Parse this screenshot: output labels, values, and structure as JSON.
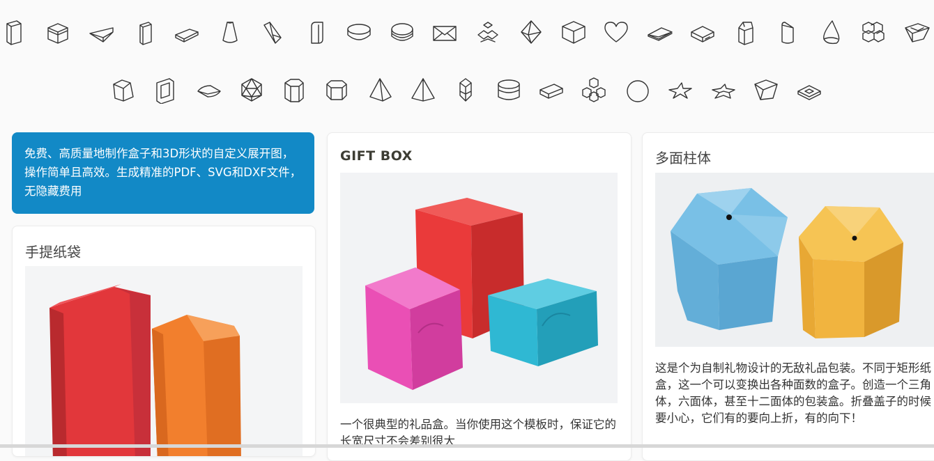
{
  "shapes_row1": [
    {
      "name": "tall-box-icon"
    },
    {
      "name": "cube-box-icon"
    },
    {
      "name": "wedge-icon"
    },
    {
      "name": "thin-box-icon"
    },
    {
      "name": "flat-box-icon"
    },
    {
      "name": "cone-icon"
    },
    {
      "name": "slanted-prism-icon"
    },
    {
      "name": "rounded-box-icon"
    },
    {
      "name": "oval-tin-icon"
    },
    {
      "name": "oval-box-icon"
    },
    {
      "name": "envelope-icon"
    },
    {
      "name": "flower-box-icon"
    },
    {
      "name": "octahedron-icon"
    },
    {
      "name": "hex-cube-icon"
    },
    {
      "name": "heart-box-icon"
    },
    {
      "name": "sleeve-envelope-icon"
    },
    {
      "name": "matchbox-icon"
    },
    {
      "name": "milk-carton-icon"
    },
    {
      "name": "cut-cylinder-icon"
    },
    {
      "name": "drop-icon"
    },
    {
      "name": "stacked-cubes-icon"
    },
    {
      "name": "tray-icon"
    }
  ],
  "shapes_row2": [
    {
      "name": "pentagon-prism-icon"
    },
    {
      "name": "frame-box-icon"
    },
    {
      "name": "pillow-box-icon"
    },
    {
      "name": "icosahedron-icon"
    },
    {
      "name": "hexagonal-prism-icon"
    },
    {
      "name": "octagon-box-icon"
    },
    {
      "name": "tetrahedron-icon"
    },
    {
      "name": "pyramid-icon"
    },
    {
      "name": "gem-icon"
    },
    {
      "name": "round-box-icon"
    },
    {
      "name": "flat-tray-icon"
    },
    {
      "name": "cube-cluster-icon"
    },
    {
      "name": "sphere-icon"
    },
    {
      "name": "star-flat-icon"
    },
    {
      "name": "star-box-icon"
    },
    {
      "name": "pentagon-box-icon"
    },
    {
      "name": "coaster-icon"
    }
  ],
  "intro": {
    "text": "免费、高质量地制作盒子和3D形状的自定义展开图，操作简单且高效。生成精准的PDF、SVG和DXF文件，无隐藏费用"
  },
  "cards": {
    "paper_bag": {
      "title": "手提纸袋"
    },
    "gift_box": {
      "title": "GIFT BOX",
      "desc": "一个很典型的礼品盒。当你使用这个模板时，保证它的长宽尺寸不会差别很大"
    },
    "prism": {
      "title": "多面柱体",
      "desc": "这是个为自制礼物设计的无敌礼品包装。不同于矩形纸盒，这一个可以变换出各种面数的盒子。创造一个三角体，六面体，甚至十二面体的包装盒。折叠盖子的时候要小心，它们有的要向上折，有的向下！"
    }
  },
  "colors": {
    "intro_bg": "#1289c6",
    "bag_red": "#e2373b",
    "bag_orange": "#f27f2d",
    "box_red": "#ea3a3a",
    "box_pink": "#ea4fb5",
    "box_cyan": "#2fb8d3",
    "prism_blue": "#6fb6dc",
    "prism_yellow": "#f1b43f"
  }
}
